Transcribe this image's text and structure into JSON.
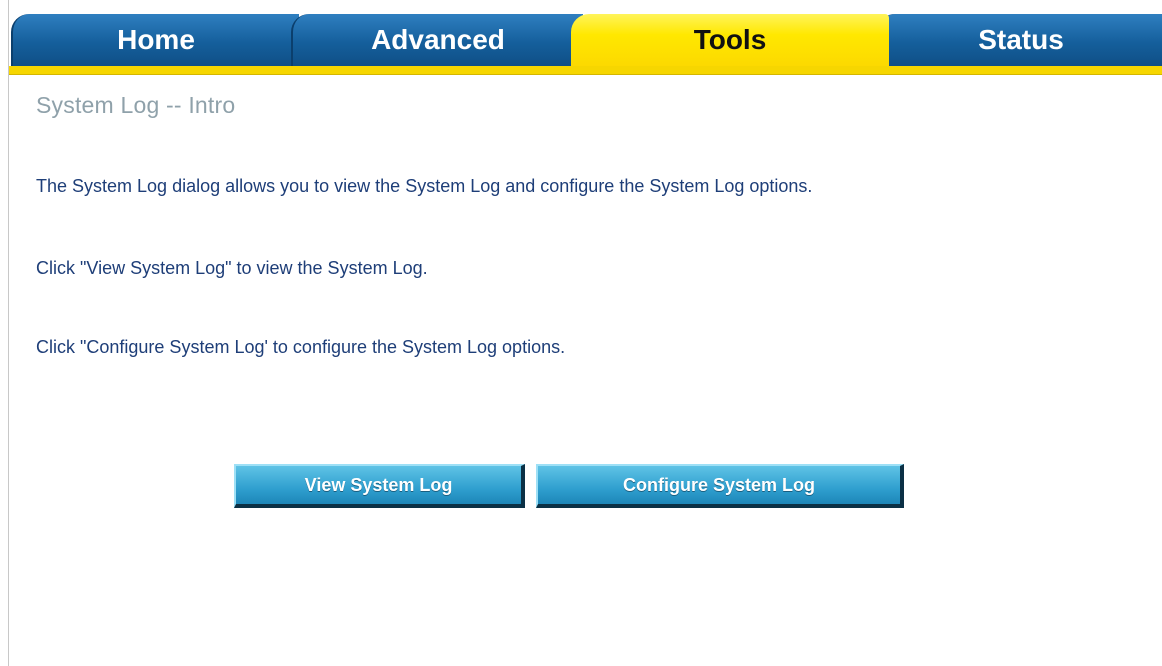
{
  "tabs": {
    "home": "Home",
    "advanced": "Advanced",
    "tools": "Tools",
    "status": "Status",
    "active": "Tools"
  },
  "page": {
    "title": "System Log -- Intro",
    "paragraphs": [
      "The System Log dialog allows you to view the System Log and configure the System Log options.",
      "Click \"View System Log\" to view the System Log.",
      "Click \"Configure System Log' to configure the System Log options."
    ]
  },
  "buttons": {
    "view": "View System Log",
    "configure": "Configure System Log"
  },
  "colors": {
    "tab_blue": "#155f9c",
    "tab_active_yellow": "#ffe800",
    "title_gray": "#8fa1aa",
    "body_text": "#1e3e78",
    "button_blue": "#2f9fcf"
  }
}
